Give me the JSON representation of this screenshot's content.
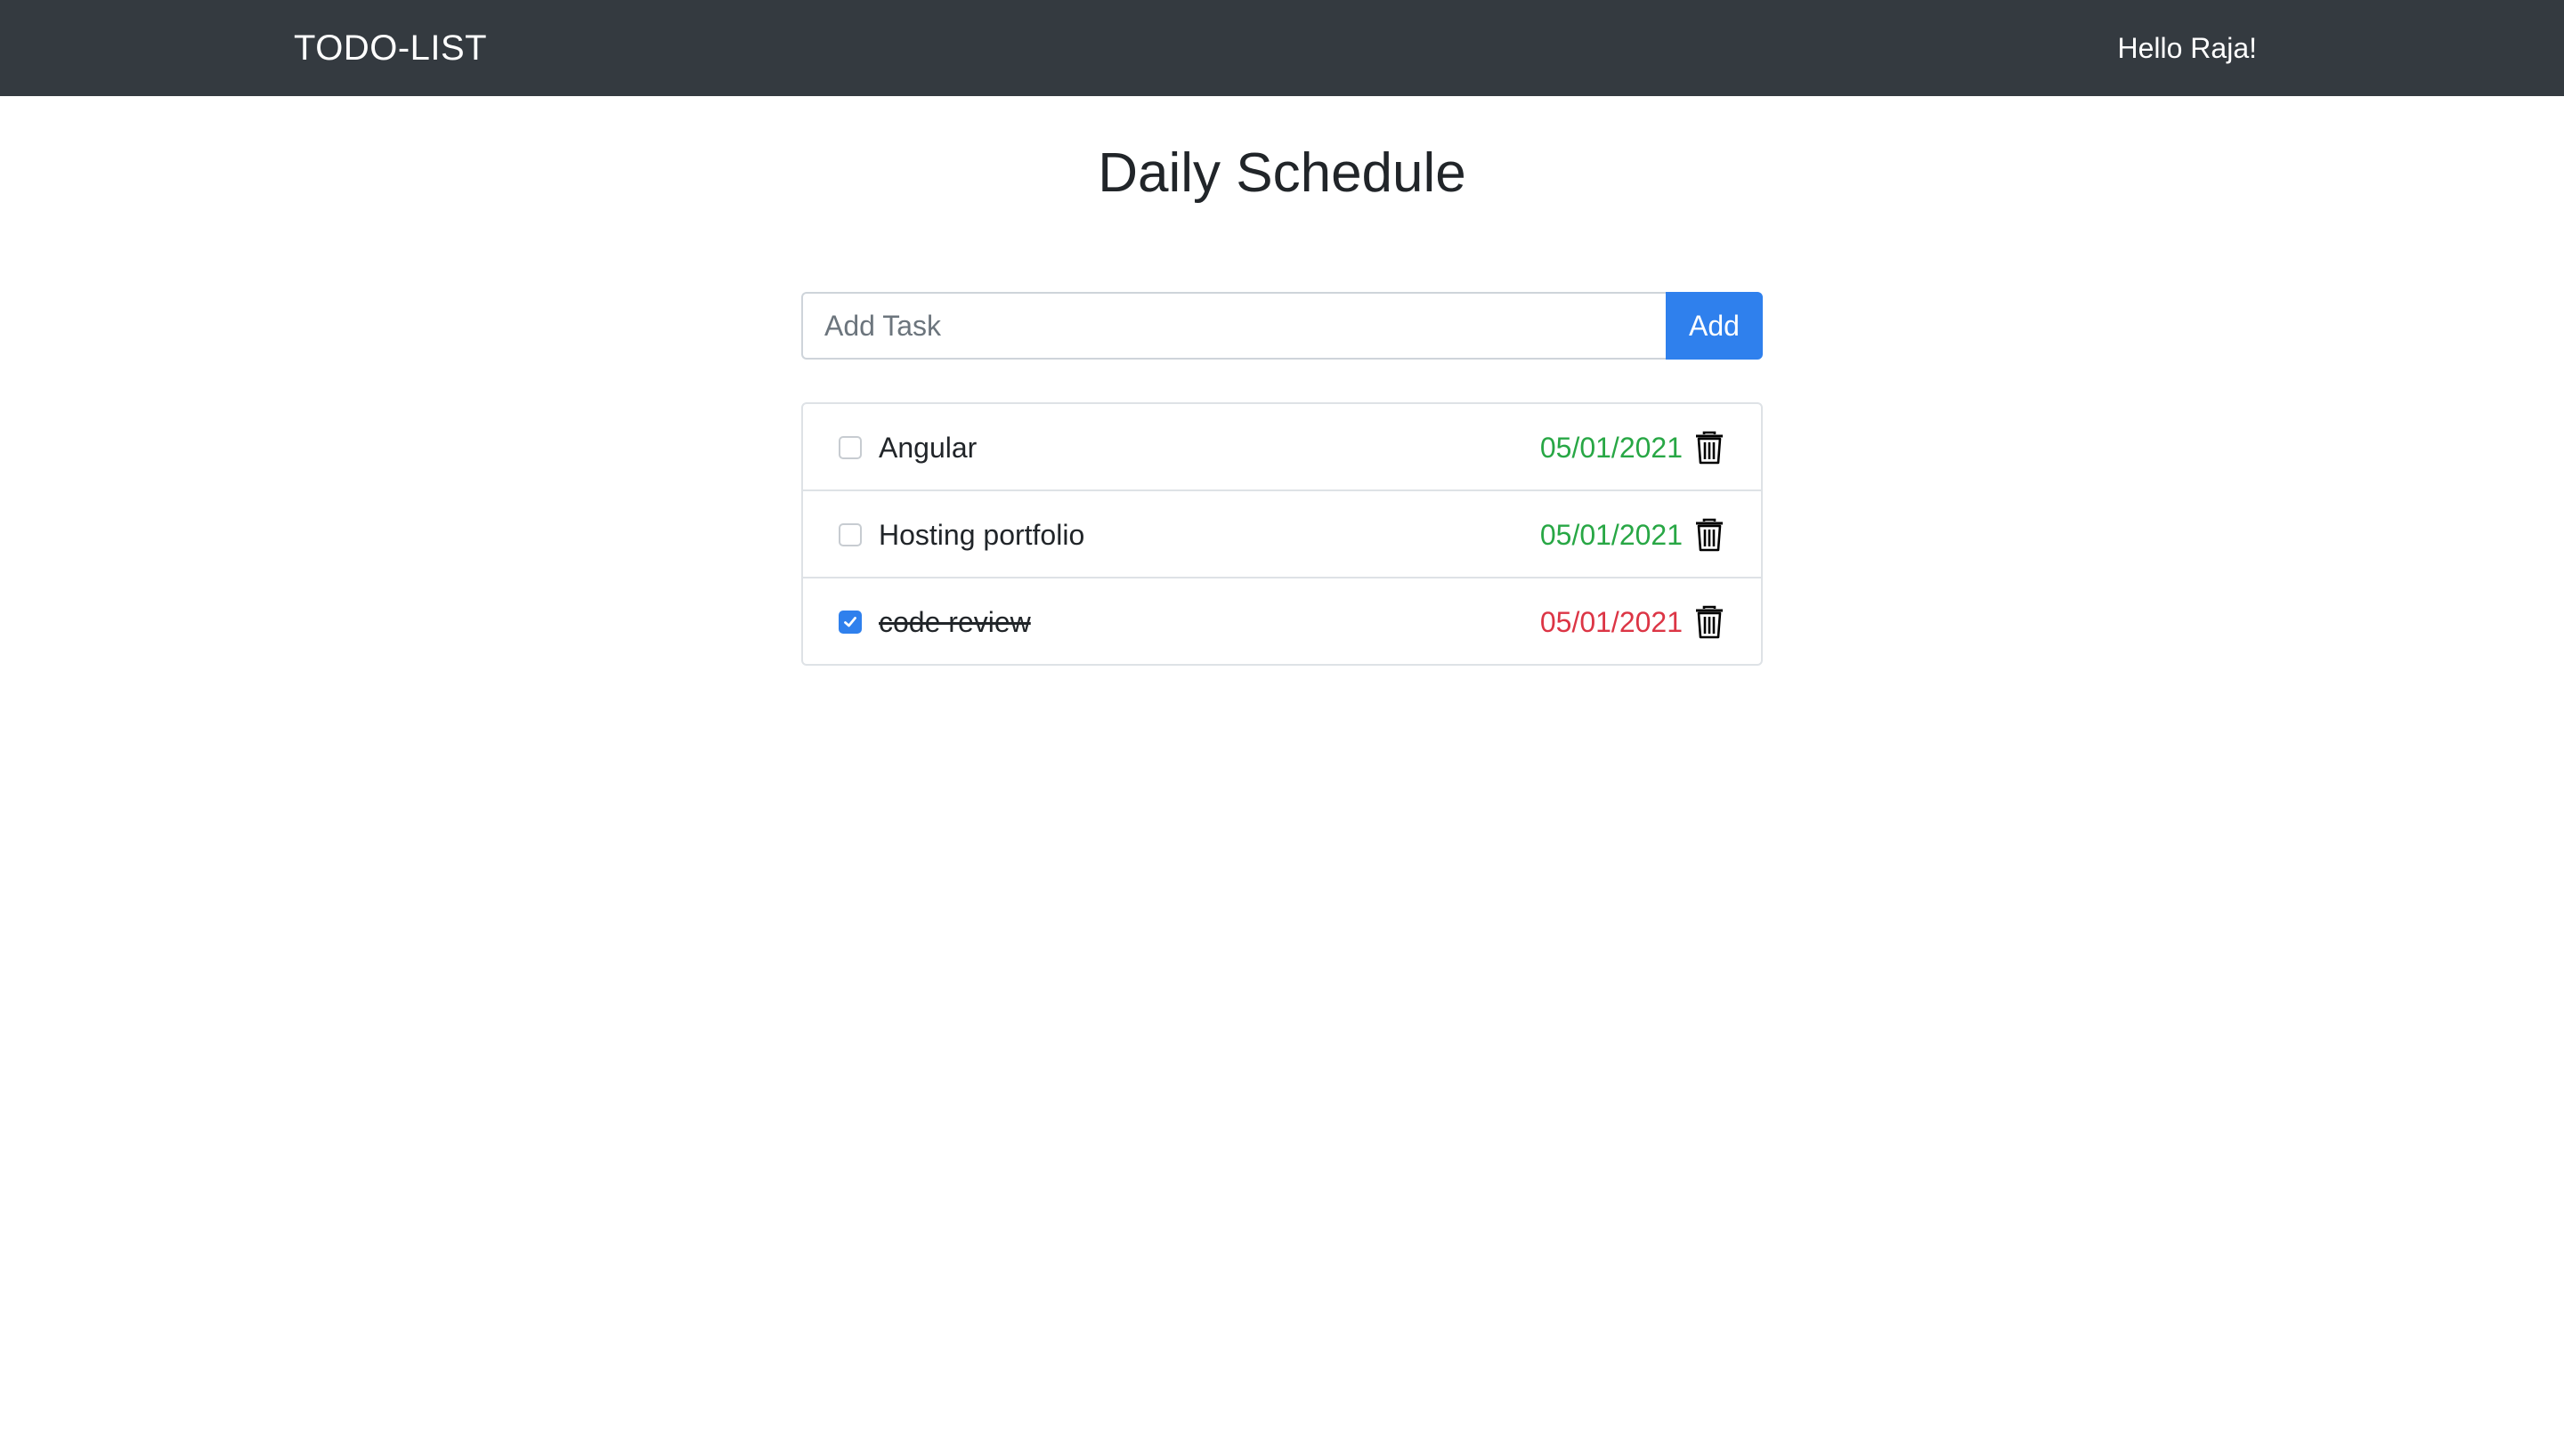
{
  "navbar": {
    "brand": "TODO-LIST",
    "greeting": "Hello Raja!",
    "background": "#343a40"
  },
  "page": {
    "title": "Daily Schedule"
  },
  "add_task": {
    "placeholder": "Add Task",
    "value": "",
    "button_label": "Add",
    "accent": "#2f80ed"
  },
  "tasks": [
    {
      "label": "Angular",
      "date": "05/01/2021",
      "date_color": "#28a745",
      "checked": false,
      "icon": "trash-icon"
    },
    {
      "label": "Hosting portfolio",
      "date": "05/01/2021",
      "date_color": "#28a745",
      "checked": false,
      "icon": "trash-icon"
    },
    {
      "label": "code review",
      "date": "05/01/2021",
      "date_color": "#dc3545",
      "checked": true,
      "icon": "trash-icon"
    }
  ]
}
